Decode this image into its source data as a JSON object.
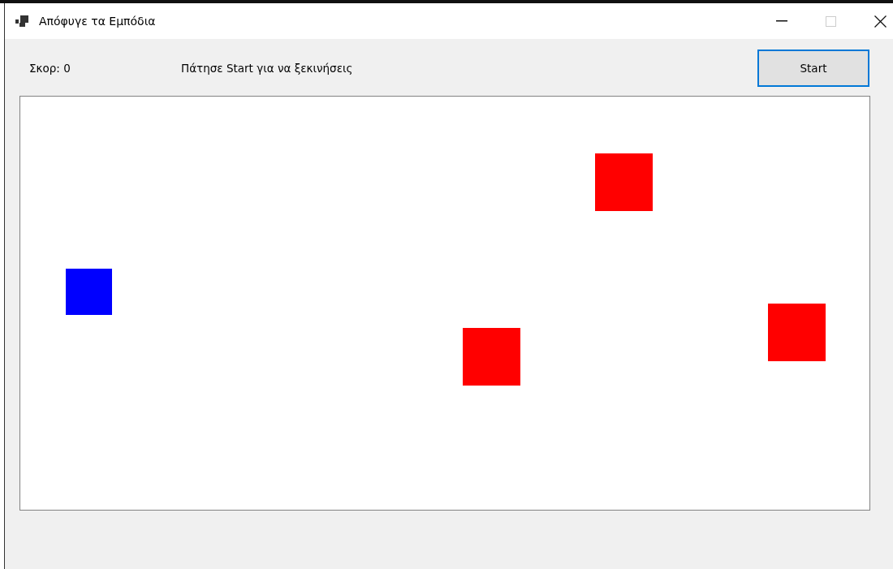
{
  "window": {
    "title": "Απόφυγε τα Εμπόδια"
  },
  "score_label": "Σκορ: 0",
  "status_text": "Πάτησε Start για να ξεκινήσεις",
  "start_button": {
    "label": "Start",
    "focused": true
  },
  "game_area": {
    "objects": [
      {
        "kind": "player",
        "color": "#0000ff"
      },
      {
        "kind": "obstacle",
        "color": "#ff0000"
      },
      {
        "kind": "obstacle",
        "color": "#ff0000"
      },
      {
        "kind": "obstacle",
        "color": "#ff0000"
      }
    ]
  }
}
